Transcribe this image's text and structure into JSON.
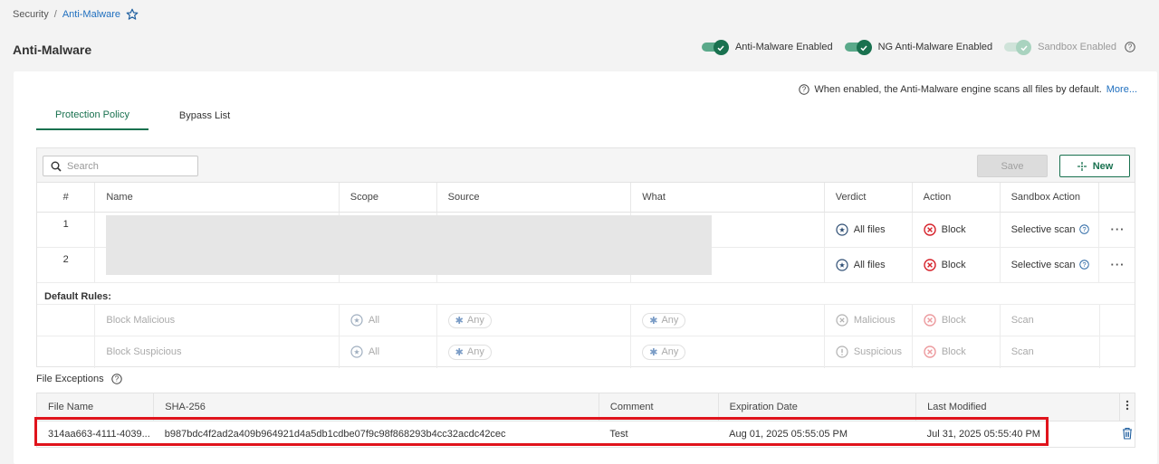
{
  "breadcrumb": {
    "root": "Security",
    "separator": "/",
    "current": "Anti-Malware"
  },
  "page": {
    "title": "Anti-Malware"
  },
  "toggles": [
    {
      "label": "Anti-Malware Enabled",
      "on": true,
      "disabled": false
    },
    {
      "label": "NG Anti-Malware Enabled",
      "on": true,
      "disabled": false
    },
    {
      "label": "Sandbox Enabled",
      "on": true,
      "disabled": true
    }
  ],
  "info": {
    "text": "When enabled, the Anti-Malware engine scans all files by default.",
    "more": "More..."
  },
  "tabs": [
    {
      "label": "Protection Policy",
      "active": true
    },
    {
      "label": "Bypass List",
      "active": false
    }
  ],
  "toolbar": {
    "search_placeholder": "Search",
    "save_label": "Save",
    "new_label": "New"
  },
  "policy_table": {
    "headers": [
      "#",
      "Name",
      "Scope",
      "Source",
      "What",
      "Verdict",
      "Action",
      "Sandbox Action"
    ],
    "rows": [
      {
        "num": "1",
        "verdict": "All files",
        "action": "Block",
        "sandbox": "Selective scan"
      },
      {
        "num": "2",
        "verdict": "All files",
        "action": "Block",
        "sandbox": "Selective scan"
      }
    ]
  },
  "default_rules": {
    "label": "Default Rules:",
    "rows": [
      {
        "name": "Block Malicious",
        "scope": "All",
        "source": "Any",
        "what": "Any",
        "verdict": "Malicious",
        "action": "Block",
        "sandbox": "Scan"
      },
      {
        "name": "Block Suspicious",
        "scope": "All",
        "source": "Any",
        "what": "Any",
        "verdict": "Suspicious",
        "action": "Block",
        "sandbox": "Scan"
      }
    ]
  },
  "file_exceptions": {
    "label": "File Exceptions",
    "headers": [
      "File Name",
      "SHA-256",
      "Comment",
      "Expiration Date",
      "Last Modified"
    ],
    "rows": [
      {
        "file_name": "314aa663-4111-4039...",
        "sha256": "b987bdc4f2ad2a409b964921d4a5db1cdbe07f9c98f868293b4cc32acdc42cec",
        "comment": "Test",
        "expiration": "Aug 01, 2025 05:55:05 PM",
        "modified": "Jul 31, 2025 05:55:40 PM"
      }
    ]
  },
  "colors": {
    "accent": "#19714f",
    "link": "#1f6fbf",
    "danger": "#d6212a",
    "highlight": "#e0141c"
  }
}
